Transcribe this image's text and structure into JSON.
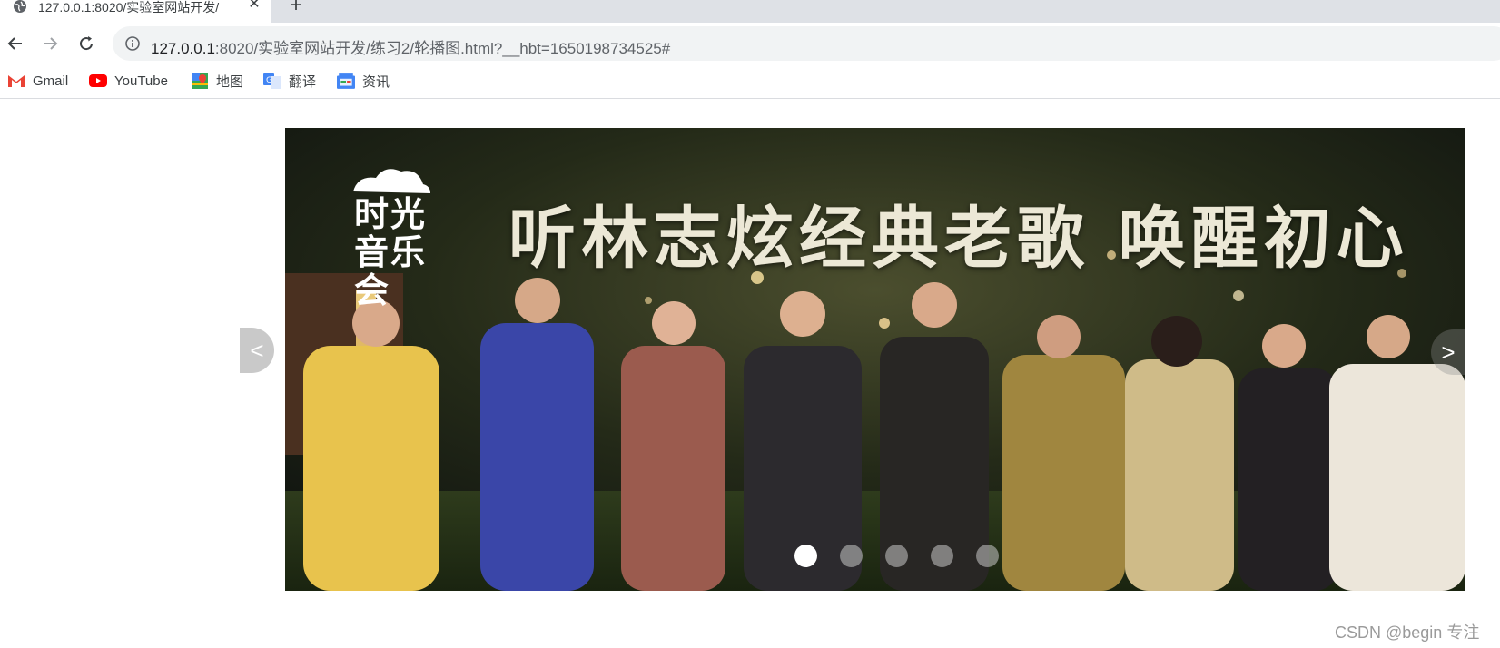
{
  "tab": {
    "title": "127.0.0.1:8020/实验室网站开发/",
    "favicon": "globe-icon",
    "close": "✕",
    "new_tab": "+"
  },
  "toolbar": {
    "url_host": "127.0.0.1",
    "url_rest": ":8020/实验室网站开发/练习2/轮播图.html?__hbt=1650198734525#"
  },
  "bookmarks": [
    {
      "label": "Gmail",
      "icon": "gmail-icon"
    },
    {
      "label": "YouTube",
      "icon": "youtube-icon"
    },
    {
      "label": "地图",
      "icon": "maps-icon"
    },
    {
      "label": "翻译",
      "icon": "translate-icon"
    },
    {
      "label": "资讯",
      "icon": "news-icon"
    }
  ],
  "carousel": {
    "heading": "听林志炫经典老歌 唤醒初心",
    "logo_line1": "时光",
    "logo_line2": "音乐会",
    "prev_label": "<",
    "next_label": ">",
    "slide_count": 5,
    "active_index": 0
  },
  "watermark": "CSDN @begin 专注"
}
